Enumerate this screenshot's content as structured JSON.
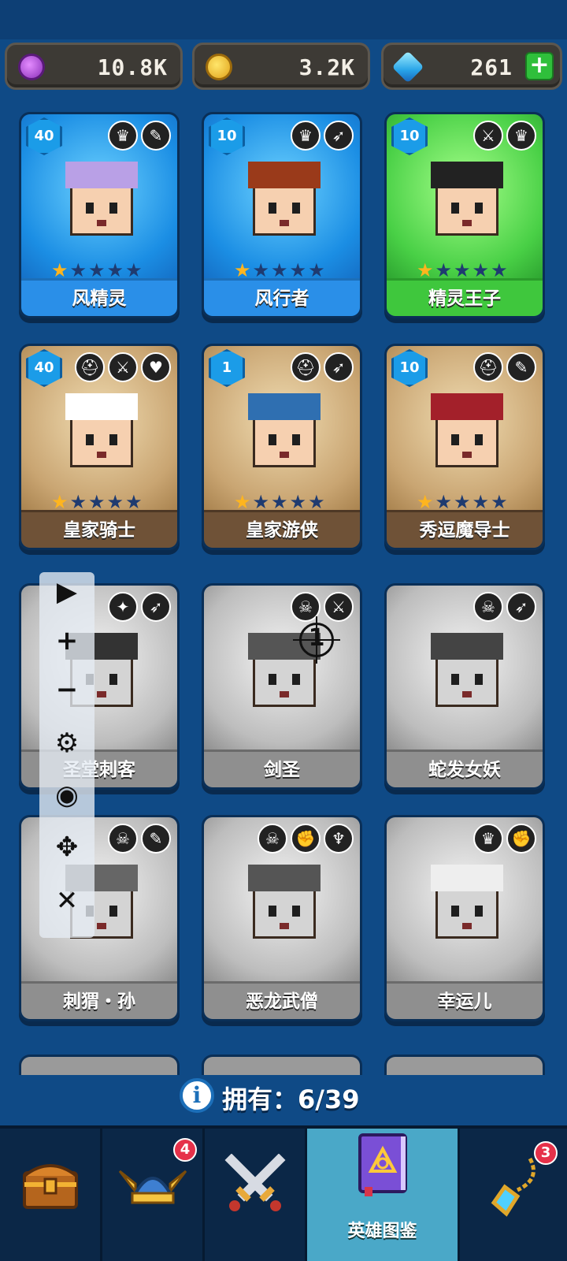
{
  "currencies": {
    "purple": {
      "value": "10.8K",
      "icon": "purple-coin-icon"
    },
    "gold": {
      "value": "3.2K",
      "icon": "gold-coin-icon"
    },
    "gem": {
      "value": "261",
      "icon": "gem-icon",
      "plus": "+"
    }
  },
  "heroes": [
    {
      "name": "风精灵",
      "level": "40",
      "stars": 1,
      "style": "blue",
      "badges": [
        "♛",
        "✎"
      ]
    },
    {
      "name": "风行者",
      "level": "10",
      "stars": 1,
      "style": "blue",
      "badges": [
        "♛",
        "➶"
      ]
    },
    {
      "name": "精灵王子",
      "level": "10",
      "stars": 1,
      "style": "green",
      "badges": [
        "⚔",
        "♛"
      ]
    },
    {
      "name": "皇家骑士",
      "level": "40",
      "stars": 1,
      "style": "brown",
      "badges": [
        "⛑",
        "⚔",
        "♥"
      ]
    },
    {
      "name": "皇家游侠",
      "level": "1",
      "stars": 1,
      "style": "brown",
      "badges": [
        "⛑",
        "➶"
      ]
    },
    {
      "name": "秀逗魔导士",
      "level": "10",
      "stars": 1,
      "style": "brown",
      "badges": [
        "⛑",
        "✎"
      ]
    },
    {
      "name": "圣堂刺客",
      "level": "",
      "stars": 0,
      "style": "gray",
      "badges": [
        "✦",
        "➶"
      ]
    },
    {
      "name": "剑圣",
      "level": "",
      "stars": 0,
      "style": "gray",
      "badges": [
        "☠",
        "⚔"
      ]
    },
    {
      "name": "蛇发女妖",
      "level": "",
      "stars": 0,
      "style": "gray",
      "badges": [
        "☠",
        "➶"
      ]
    },
    {
      "name": "刺猬・孙",
      "level": "",
      "stars": 0,
      "style": "gray",
      "badges": [
        "☠",
        "✎"
      ]
    },
    {
      "name": "恶龙武僧",
      "level": "",
      "stars": 0,
      "style": "gray",
      "badges": [
        "☠",
        "✊",
        "♆"
      ]
    },
    {
      "name": "幸运儿",
      "level": "",
      "stars": 0,
      "style": "gray",
      "badges": [
        "♛",
        "✊"
      ]
    }
  ],
  "floating_toolbar": {
    "play": "▶",
    "zoom_in": "+",
    "zoom_out": "−",
    "settings": "⚙",
    "hide": "◉",
    "move": "✥",
    "close": "✕"
  },
  "crosshair": {
    "number": "1"
  },
  "owned": {
    "label": "拥有：6/39",
    "info_icon": "i"
  },
  "nav": {
    "items": [
      {
        "name": "chest",
        "label": ""
      },
      {
        "name": "heroes-helmet",
        "label": "",
        "badge": "4"
      },
      {
        "name": "battle",
        "label": ""
      },
      {
        "name": "hero-codex",
        "label": "英雄图鉴"
      },
      {
        "name": "amulet",
        "label": "",
        "badge": "3"
      }
    ]
  },
  "colors": {
    "background": "#0f4a86",
    "nav_active": "#4aa8c8",
    "star_on": "#ffb51e",
    "notif_badge": "#e6314a"
  }
}
